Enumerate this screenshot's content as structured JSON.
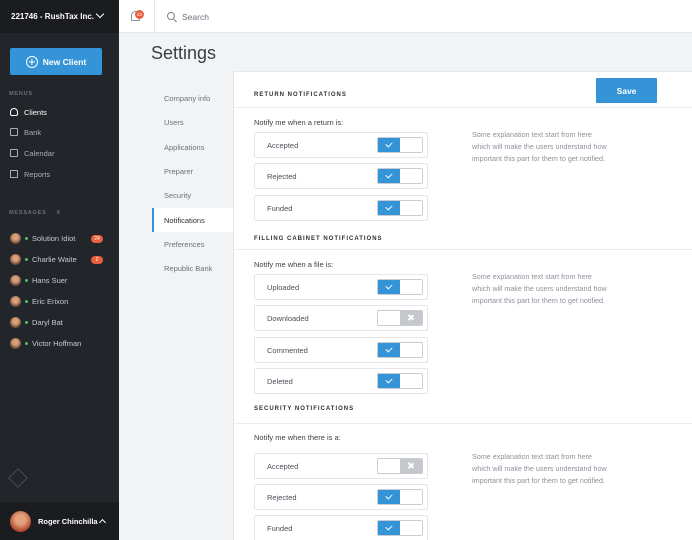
{
  "account": {
    "name": "221746 - RushTax Inc."
  },
  "sidebar": {
    "new_client_label": "New Client",
    "menus_title": "MENUS",
    "menu_items": [
      {
        "label": "Clients",
        "icon": "user-icon",
        "active": true
      },
      {
        "label": "Bank",
        "icon": "bank-icon",
        "active": false
      },
      {
        "label": "Calendar",
        "icon": "calendar-icon",
        "active": false
      },
      {
        "label": "Reports",
        "icon": "reports-icon",
        "active": false
      }
    ],
    "messages_title": "MESSAGES",
    "messages_count": "6",
    "messages": [
      {
        "name": "Solution Idiot",
        "badge": "24"
      },
      {
        "name": "Charlie Waite",
        "badge": "2"
      },
      {
        "name": "Hans Suer",
        "badge": ""
      },
      {
        "name": "Eric Erixon",
        "badge": ""
      },
      {
        "name": "Daryl Bat",
        "badge": ""
      },
      {
        "name": "Victor Hoffman",
        "badge": ""
      }
    ],
    "user_name": "Roger Chinchilla"
  },
  "topbar": {
    "notification_count": "22",
    "search_placeholder": "Search"
  },
  "page": {
    "title": "Settings"
  },
  "settings_nav": [
    {
      "label": "Company info",
      "active": false
    },
    {
      "label": "Users",
      "active": false
    },
    {
      "label": "Applications",
      "active": false
    },
    {
      "label": "Preparer",
      "active": false
    },
    {
      "label": "Security",
      "active": false
    },
    {
      "label": "Notifications",
      "active": true
    },
    {
      "label": "Preferences",
      "active": false
    },
    {
      "label": "Republic Bank",
      "active": false
    }
  ],
  "save_label": "Save",
  "sections": [
    {
      "title": "RETURN NOTIFICATIONS",
      "notify_label": "Notify me when a return is:",
      "explanation": "Some explanation text start from here which will make the users understand how important this part for them to get notified.",
      "options": [
        {
          "label": "Accepted",
          "on": true
        },
        {
          "label": "Rejected",
          "on": true
        },
        {
          "label": "Funded",
          "on": true
        }
      ]
    },
    {
      "title": "FILLING CABINET NOTIFICATIONS",
      "notify_label": "Notify me when a file is:",
      "explanation": "Some explanation text start from here which will make the users understand how important this part for them to get notified.",
      "options": [
        {
          "label": "Uploaded",
          "on": true
        },
        {
          "label": "Downloaded",
          "on": false
        },
        {
          "label": "Commented",
          "on": true
        },
        {
          "label": "Deleted",
          "on": true
        }
      ]
    },
    {
      "title": "SECURITY NOTIFICATIONS",
      "notify_label": "Notify me when there is a:",
      "explanation": "Some explanation text start from here which will make the users understand how important this part for them to get notified.",
      "options": [
        {
          "label": "Accepted",
          "on": false
        },
        {
          "label": "Rejected",
          "on": true
        },
        {
          "label": "Funded",
          "on": true
        }
      ]
    }
  ],
  "colors": {
    "accent": "#3594d7",
    "sidebar": "#22252a",
    "badge": "#e8603c",
    "toggle_off": "#c4c7cc"
  }
}
